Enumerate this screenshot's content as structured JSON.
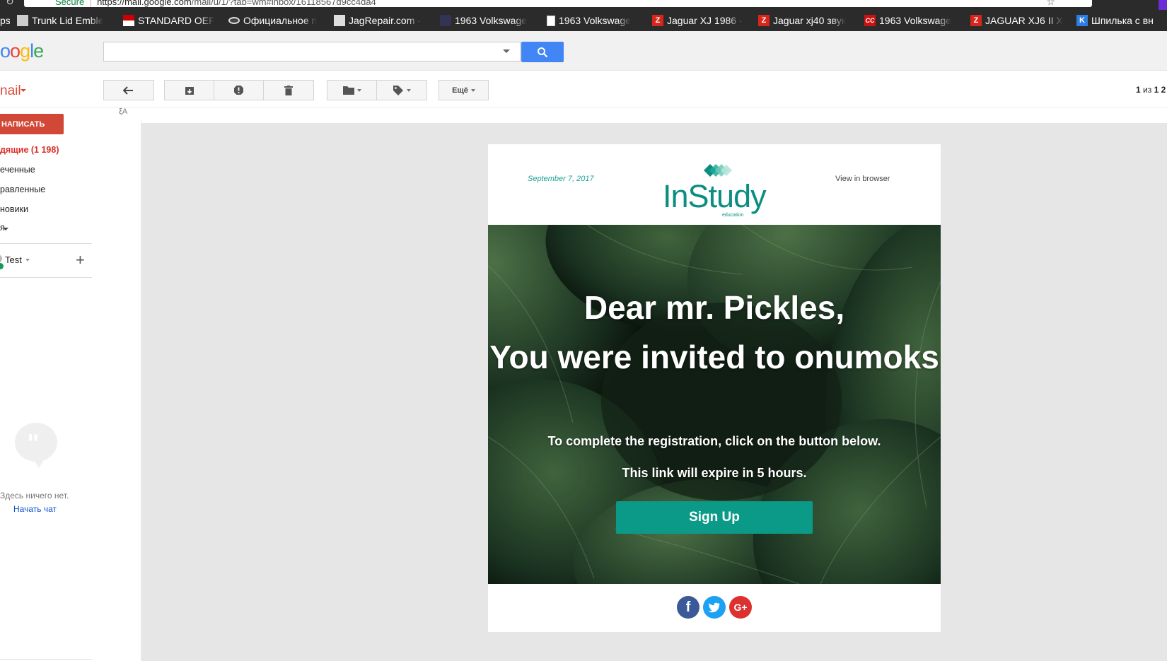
{
  "browser": {
    "url_secure": "Secure",
    "url_host": "https://mail.google.com",
    "url_path": "/mail/u/1/?tab=wm#inbox/16118567d9cc4da4",
    "bookmarks": [
      {
        "label": "ps",
        "icon": "none"
      },
      {
        "label": "Trunk Lid Emble",
        "icon": "trunk-icon"
      },
      {
        "label": "STANDARD OEF",
        "icon": "flag-icon"
      },
      {
        "label": "Официальное п",
        "icon": "oval-icon"
      },
      {
        "label": "JagRepair.com -",
        "icon": "jag-icon"
      },
      {
        "label": "1963 Volkswage",
        "icon": "car-icon"
      },
      {
        "label": "1963 Volkswage",
        "icon": "doc-icon"
      },
      {
        "label": "Jaguar XJ 1986 -",
        "icon": "z-icon"
      },
      {
        "label": "Jaguar xj40 звук",
        "icon": "z-icon"
      },
      {
        "label": "1963 Volkswage",
        "icon": "cc-icon"
      },
      {
        "label": "JAGUAR XJ6 II X",
        "icon": "z-icon"
      },
      {
        "label": "Шпилька с вн",
        "icon": "k-icon"
      }
    ]
  },
  "gmail": {
    "logo_partial": "oogle",
    "mail_label": "nail",
    "search_placeholder": "",
    "toolbar": {
      "more_label": "Ещё",
      "pager_range": "1",
      "pager_sep": "из",
      "pager_total": "1 2"
    },
    "nav": {
      "compose_label": "НАПИСАТЬ",
      "items": [
        {
          "label": "дящие (1 198)",
          "active": true
        },
        {
          "label": "еченные",
          "active": false
        },
        {
          "label": "равленные",
          "active": false
        },
        {
          "label": "новики",
          "active": false
        }
      ],
      "more_label": "я"
    },
    "hangouts": {
      "user": "Test",
      "empty_text": "Здесь ничего нет.",
      "start_chat": "Начать чат"
    }
  },
  "email": {
    "date": "September 7, 2017",
    "view_in_browser": "View in browser",
    "logo_text": "InStudy",
    "logo_sub": "education",
    "greeting": "Dear mr. Pickles,",
    "invite_line": "You were invited to onumoks",
    "instruction": "To complete the registration, click on the button below.",
    "expiry": "This link will expire in 5 hours.",
    "button_label": "Sign Up",
    "accent_color": "#0b9a88",
    "social": [
      "facebook-icon",
      "twitter-icon",
      "google-plus-icon"
    ]
  }
}
